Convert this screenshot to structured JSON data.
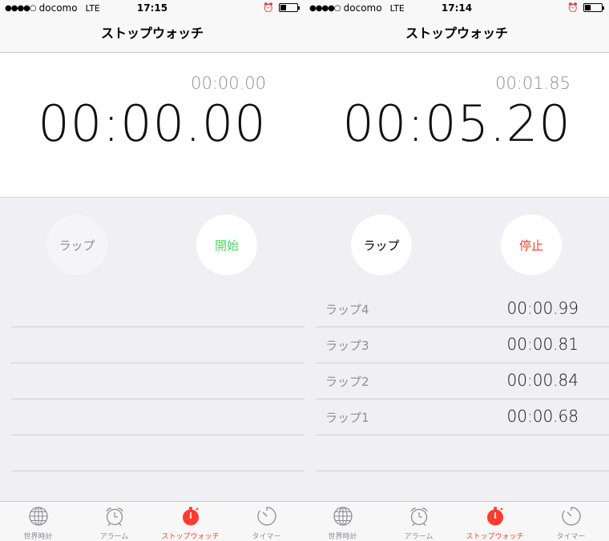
{
  "colors": {
    "start_green": "#4cd964",
    "stop_red": "#ff3b30",
    "active_tab": "#ff3b30"
  },
  "screens": [
    {
      "status": {
        "signal": "●●●●○",
        "carrier": "docomo",
        "network": "LTE",
        "time": "17:15",
        "battery_fraction": 0.35
      },
      "title": "ストップウォッチ",
      "lap_time": "00:00.00",
      "main_time": "00:00.00",
      "lap_button": "ラップ",
      "main_button": "開始",
      "laps": [
        {
          "label": "",
          "value": ""
        },
        {
          "label": "",
          "value": ""
        },
        {
          "label": "",
          "value": ""
        },
        {
          "label": "",
          "value": ""
        },
        {
          "label": "",
          "value": ""
        }
      ],
      "tabs": [
        {
          "label": "世界時計",
          "icon": "globe-icon"
        },
        {
          "label": "アラーム",
          "icon": "alarm-icon"
        },
        {
          "label": "ストップウォッチ",
          "icon": "stopwatch-icon"
        },
        {
          "label": "タイマー",
          "icon": "timer-icon"
        }
      ],
      "active_tab": 2
    },
    {
      "status": {
        "signal": "●●●●○",
        "carrier": "docomo",
        "network": "LTE",
        "time": "17:14",
        "battery_fraction": 0.35
      },
      "title": "ストップウォッチ",
      "lap_time": "00:01.85",
      "main_time": "00:05.20",
      "lap_button": "ラップ",
      "main_button": "停止",
      "laps": [
        {
          "label": "ラップ4",
          "value": "00:00.99"
        },
        {
          "label": "ラップ3",
          "value": "00:00.81"
        },
        {
          "label": "ラップ2",
          "value": "00:00.84"
        },
        {
          "label": "ラップ1",
          "value": "00:00.68"
        },
        {
          "label": "",
          "value": ""
        }
      ],
      "tabs": [
        {
          "label": "世界時計",
          "icon": "globe-icon"
        },
        {
          "label": "アラーム",
          "icon": "alarm-icon"
        },
        {
          "label": "ストップウォッチ",
          "icon": "stopwatch-icon"
        },
        {
          "label": "タイマー",
          "icon": "timer-icon"
        }
      ],
      "active_tab": 2
    }
  ]
}
